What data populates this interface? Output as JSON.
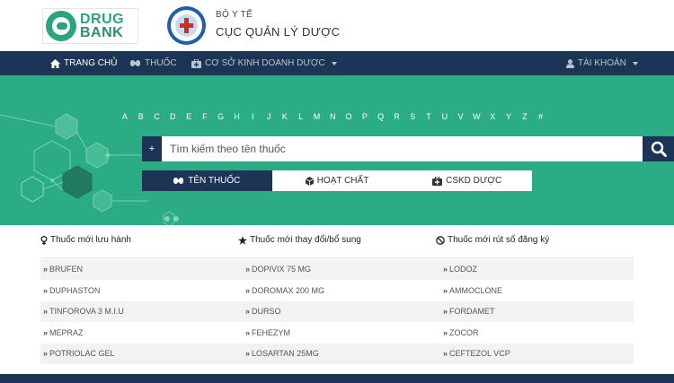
{
  "header": {
    "logo": {
      "line1": "DRUG",
      "line2": "BANK"
    },
    "org_parent": "BỘ Y TẾ",
    "org_name": "CỤC QUẢN LÝ DƯỢC"
  },
  "nav": {
    "items": [
      {
        "label": "TRANG CHỦ",
        "icon": "home-icon",
        "active": true
      },
      {
        "label": "THUỐC",
        "icon": "pills-icon",
        "active": false
      },
      {
        "label": "CƠ SỞ KINH DOANH DƯỢC",
        "icon": "medkit-icon",
        "active": false
      }
    ],
    "account": {
      "label": "TÀI KHOẢN",
      "icon": "user-icon"
    }
  },
  "hero": {
    "alphabet": [
      "A",
      "B",
      "C",
      "D",
      "E",
      "F",
      "G",
      "H",
      "I",
      "J",
      "K",
      "L",
      "M",
      "N",
      "O",
      "P",
      "Q",
      "R",
      "S",
      "T",
      "U",
      "V",
      "W",
      "X",
      "Y",
      "Z",
      "#"
    ],
    "search": {
      "plus_label": "+",
      "placeholder": "Tìm kiếm theo tên thuốc",
      "value": ""
    },
    "tabs": [
      {
        "label": "TÊN THUỐC",
        "icon": "pills-icon",
        "active": true
      },
      {
        "label": "HOẠT CHẤT",
        "icon": "cube-icon",
        "active": false
      },
      {
        "label": "CSKD DƯỢC",
        "icon": "medkit-icon",
        "active": false
      }
    ]
  },
  "lists": {
    "columns": [
      {
        "title": "Thuốc mới lưu hành",
        "icon": "female-icon",
        "items": [
          "BRUFEN",
          "DUPHASTON",
          "TINFOROVA 3 M.I.U",
          "MEPRAZ",
          "POTRIOLAC GEL"
        ]
      },
      {
        "title": "Thuốc mới thay đổi/bổ sung",
        "icon": "star-icon",
        "items": [
          "DOPIVIX 75 MG",
          "DOROMAX 200 MG",
          "DURSO",
          "FEHEZYM",
          "LOSARTAN 25MG"
        ]
      },
      {
        "title": "Thuốc mới rút số đăng ký",
        "icon": "ban-icon",
        "items": [
          "LODOZ",
          "AMMOCLONE",
          "FORDAMET",
          "ZOCOR",
          "CEFTEZOL VCP"
        ]
      }
    ]
  },
  "colors": {
    "navy": "#1c3556",
    "green": "#2bac85"
  }
}
